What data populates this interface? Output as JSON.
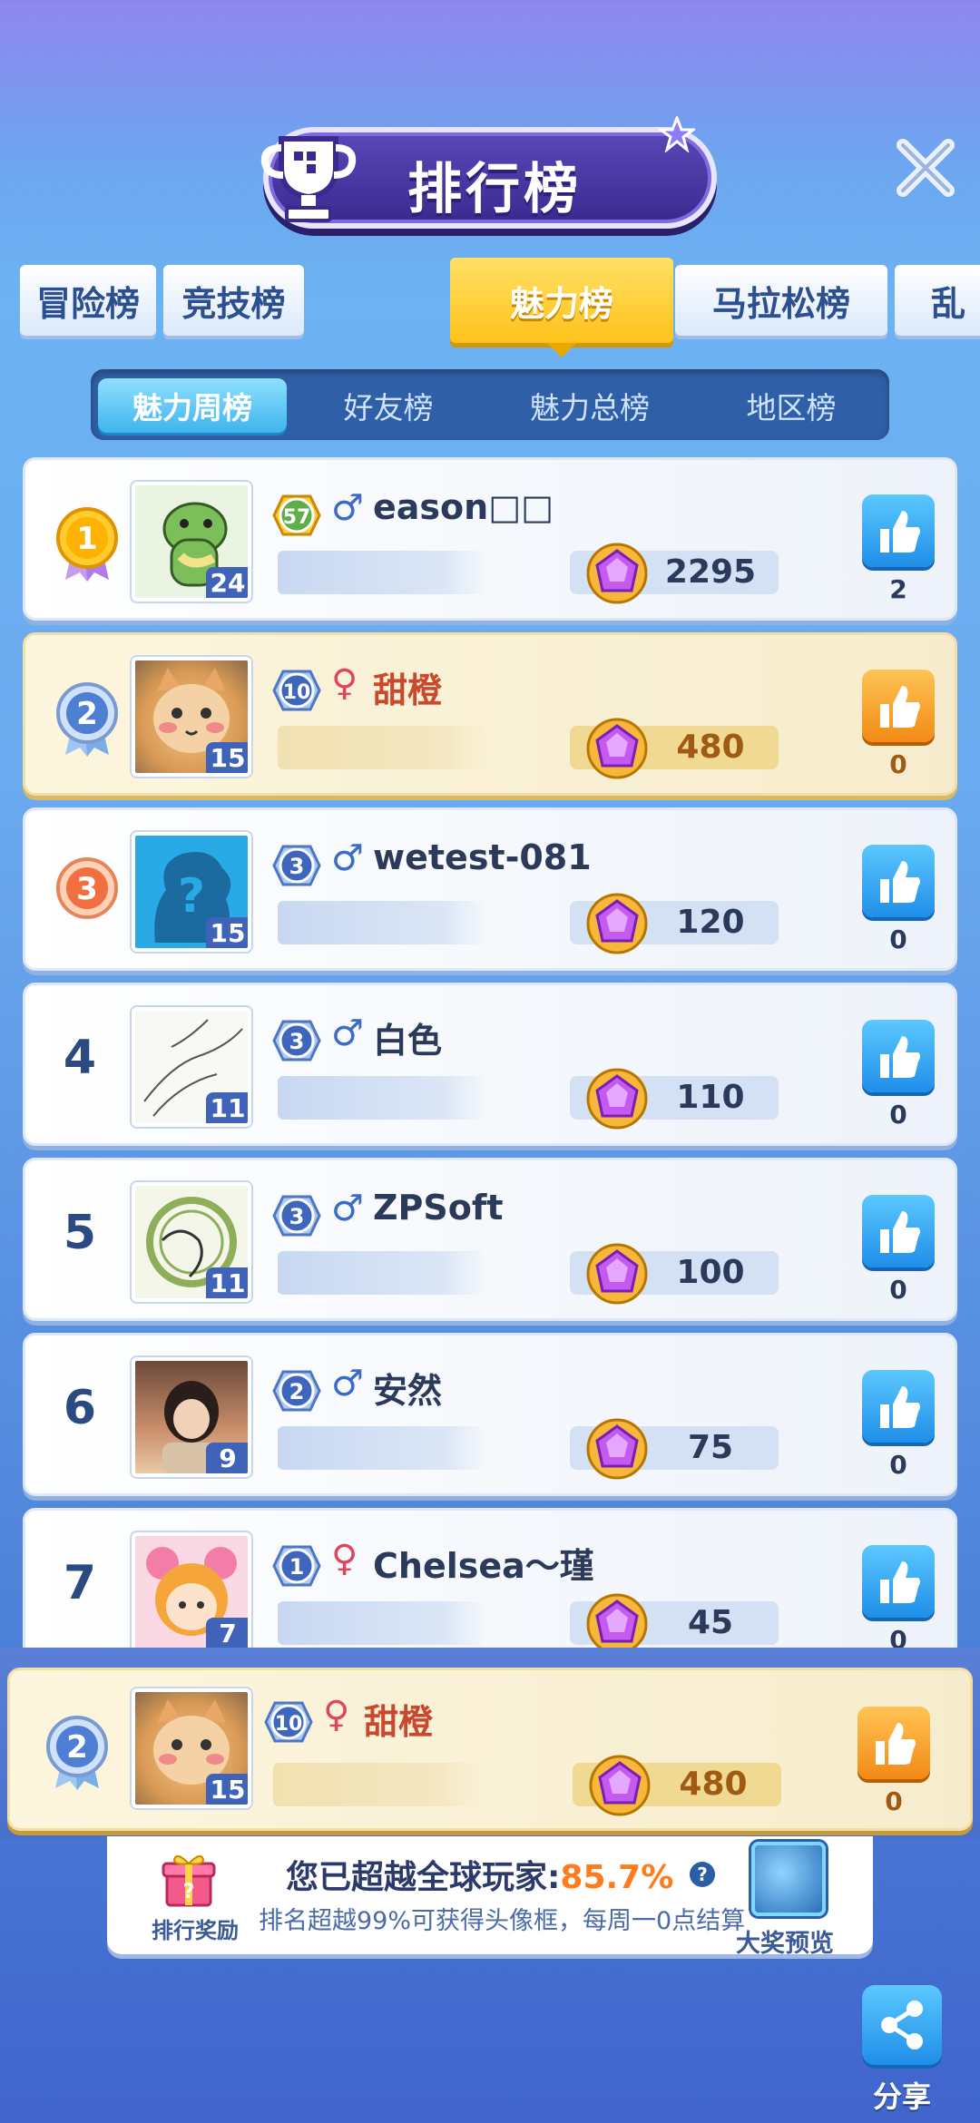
{
  "header": {
    "title": "排行榜"
  },
  "tabs": [
    {
      "label": "冒险榜"
    },
    {
      "label": "竞技榜"
    },
    {
      "label": "魅力榜",
      "active": true
    },
    {
      "label": "马拉松榜"
    },
    {
      "label": "乱"
    }
  ],
  "subtabs": [
    {
      "label": "魅力周榜",
      "active": true
    },
    {
      "label": "好友榜"
    },
    {
      "label": "魅力总榜"
    },
    {
      "label": "地区榜"
    }
  ],
  "rows": [
    {
      "rank": "1",
      "level": "57",
      "gender": "♂",
      "name": "eason□□",
      "avatar_level": "24",
      "score": "2295",
      "likes": "2",
      "avatar": "dino-avatar"
    },
    {
      "rank": "2",
      "level": "10",
      "gender": "♀",
      "name": "甜橙",
      "avatar_level": "15",
      "score": "480",
      "likes": "0",
      "avatar": "cat-avatar",
      "is_me": true
    },
    {
      "rank": "3",
      "level": "3",
      "gender": "♂",
      "name": "wetest-081",
      "avatar_level": "15",
      "score": "120",
      "likes": "0",
      "avatar": "unknown-avatar"
    },
    {
      "rank": "4",
      "level": "3",
      "gender": "♂",
      "name": "白色",
      "avatar_level": "11",
      "score": "110",
      "likes": "0",
      "avatar": "sketch-avatar"
    },
    {
      "rank": "5",
      "level": "3",
      "gender": "♂",
      "name": "ZPSoft",
      "avatar_level": "11",
      "score": "100",
      "likes": "0",
      "avatar": "seal-avatar"
    },
    {
      "rank": "6",
      "level": "2",
      "gender": "♂",
      "name": "安然",
      "avatar_level": "9",
      "score": "75",
      "likes": "0",
      "avatar": "anime-avatar"
    },
    {
      "rank": "7",
      "level": "1",
      "gender": "♀",
      "name": "Chelsea～瑾",
      "avatar_level": "7",
      "score": "45",
      "likes": "0",
      "avatar": "girl-avatar"
    }
  ],
  "my_row": {
    "rank": "2",
    "level": "10",
    "gender": "♀",
    "name": "甜橙",
    "avatar_level": "15",
    "score": "480",
    "likes": "0"
  },
  "reward": {
    "left_label": "排行奖励",
    "line1_prefix": "您已超越全球玩家:",
    "line1_pct": "85.7%",
    "help": "?",
    "line2": "排名超越99%可获得头像框，每周一0点结算",
    "right_label": "大奖预览"
  },
  "share": {
    "label": "分享"
  },
  "colors": {
    "accent_gold": "#ffc21a",
    "like_blue": "#1f8ee8",
    "like_orange": "#f28a16",
    "pct_orange": "#ff7b1c"
  }
}
